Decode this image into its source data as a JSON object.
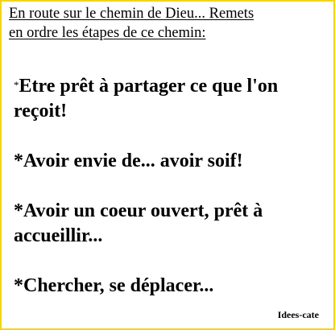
{
  "header": {
    "line1": "En route sur le chemin de Dieu... Remets",
    "line2": "en ordre les étapes de ce chemin:"
  },
  "steps": [
    {
      "prefix": "*",
      "text": "Etre prêt à partager ce que l'on reçoit!"
    },
    {
      "prefix": "*",
      "text": "Avoir envie de... avoir soif!"
    },
    {
      "prefix": "*",
      "text": "Avoir un coeur ouvert, prêt à accueillir..."
    },
    {
      "prefix": "*",
      "text": "Chercher, se déplacer..."
    }
  ],
  "credit": "Idees-cate",
  "colors": {
    "border": "#f3d31a",
    "text": "#000000",
    "background": "#ffffff"
  }
}
